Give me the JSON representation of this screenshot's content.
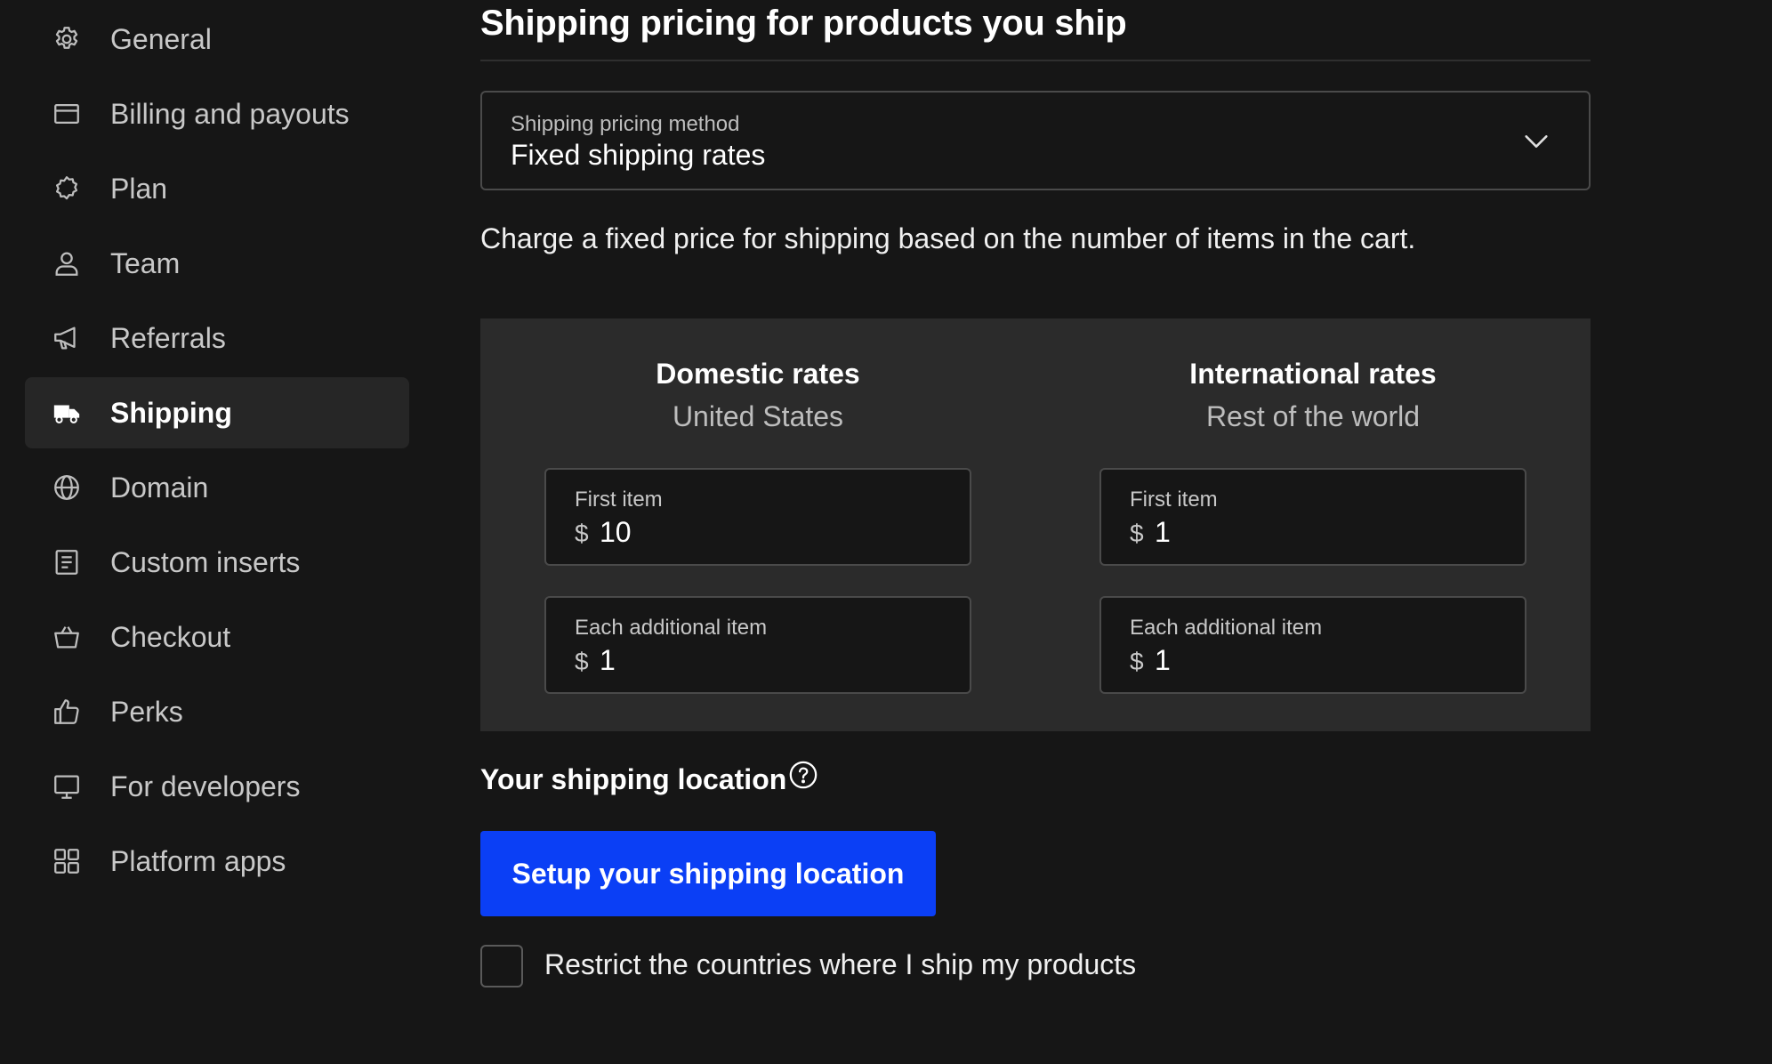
{
  "sidebar": {
    "items": [
      {
        "label": "General",
        "icon": "gear-icon"
      },
      {
        "label": "Billing and payouts",
        "icon": "credit-card-icon"
      },
      {
        "label": "Plan",
        "icon": "badge-icon"
      },
      {
        "label": "Team",
        "icon": "user-icon"
      },
      {
        "label": "Referrals",
        "icon": "megaphone-icon"
      },
      {
        "label": "Shipping",
        "icon": "truck-icon",
        "active": true
      },
      {
        "label": "Domain",
        "icon": "globe-icon"
      },
      {
        "label": "Custom inserts",
        "icon": "document-icon"
      },
      {
        "label": "Checkout",
        "icon": "basket-icon"
      },
      {
        "label": "Perks",
        "icon": "thumbs-up-icon"
      },
      {
        "label": "For developers",
        "icon": "monitor-icon"
      },
      {
        "label": "Platform apps",
        "icon": "grid-icon"
      }
    ]
  },
  "main": {
    "title": "Shipping pricing for products you ship",
    "pricing_method": {
      "label": "Shipping pricing method",
      "value": "Fixed shipping rates"
    },
    "description": "Charge a fixed price for shipping based on the number of items in the cart.",
    "rates": {
      "domestic": {
        "title": "Domestic rates",
        "subtitle": "United States",
        "first_item": {
          "label": "First item",
          "currency": "$",
          "value": "10"
        },
        "additional_item": {
          "label": "Each additional item",
          "currency": "$",
          "value": "1"
        }
      },
      "international": {
        "title": "International rates",
        "subtitle": "Rest of the world",
        "first_item": {
          "label": "First item",
          "currency": "$",
          "value": "1"
        },
        "additional_item": {
          "label": "Each additional item",
          "currency": "$",
          "value": "1"
        }
      }
    },
    "location": {
      "heading": "Your shipping location",
      "button_label": "Setup your shipping location",
      "restrict_label": "Restrict the countries where I ship my products",
      "restrict_checked": false
    }
  },
  "colors": {
    "background": "#161616",
    "panel": "#2b2b2b",
    "active_nav": "#262626",
    "primary_button": "#0b3ff5"
  }
}
